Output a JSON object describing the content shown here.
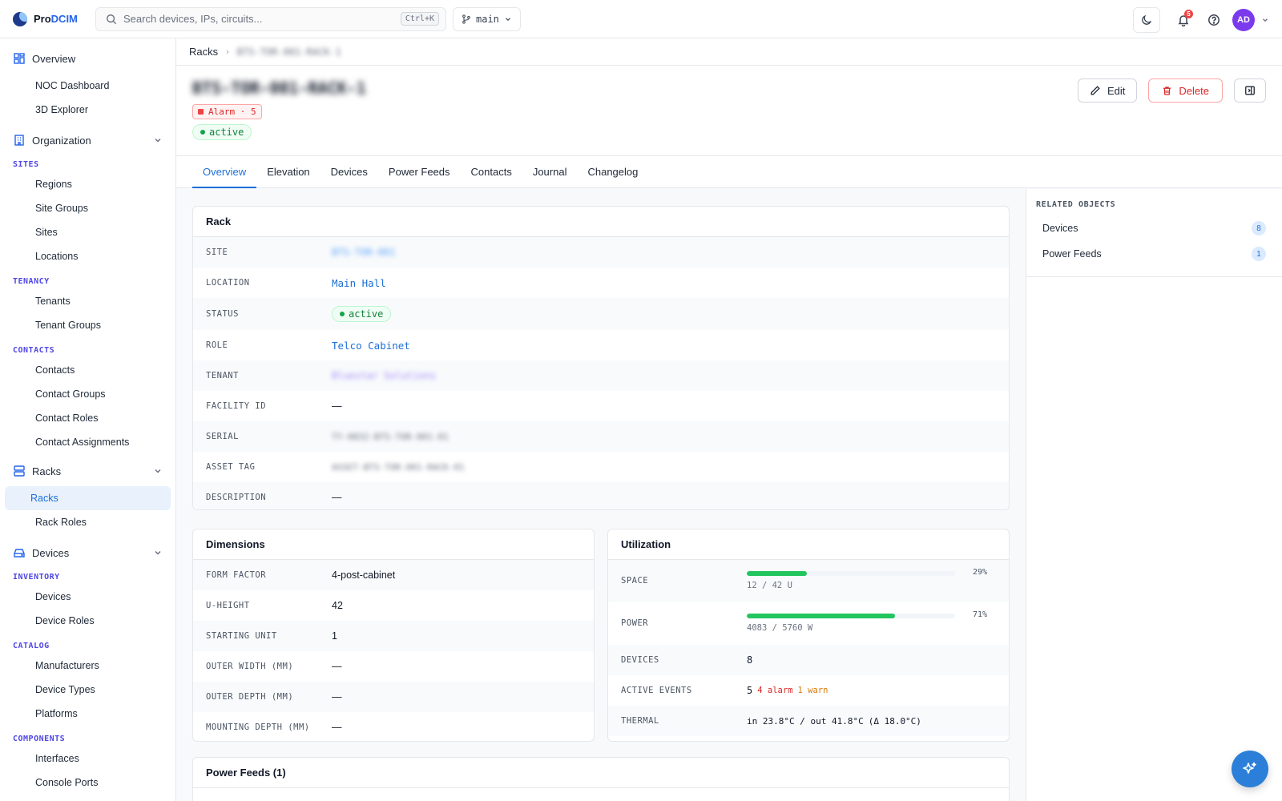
{
  "app": {
    "logo_prefix": "Pro",
    "logo_accent": "DCIM"
  },
  "search": {
    "placeholder": "Search devices, IPs, circuits...",
    "shortcut": "Ctrl+K"
  },
  "branch": {
    "label": "main"
  },
  "topbar": {
    "notification_count": "5",
    "avatar_initials": "AD"
  },
  "sidebar": {
    "overview": {
      "label": "Overview",
      "items": [
        "NOC Dashboard",
        "3D Explorer"
      ]
    },
    "organization": {
      "label": "Organization",
      "sites_cat": "SITES",
      "sites": [
        "Regions",
        "Site Groups",
        "Sites",
        "Locations"
      ],
      "tenancy_cat": "TENANCY",
      "tenancy": [
        "Tenants",
        "Tenant Groups"
      ],
      "contacts_cat": "CONTACTS",
      "contacts": [
        "Contacts",
        "Contact Groups",
        "Contact Roles",
        "Contact Assignments"
      ]
    },
    "racks": {
      "label": "Racks",
      "items": [
        "Racks",
        "Rack Roles"
      ]
    },
    "devices": {
      "label": "Devices",
      "inventory_cat": "INVENTORY",
      "inventory": [
        "Devices",
        "Device Roles"
      ],
      "catalog_cat": "CATALOG",
      "catalog": [
        "Manufacturers",
        "Device Types",
        "Platforms"
      ],
      "components_cat": "COMPONENTS",
      "components": [
        "Interfaces",
        "Console Ports"
      ]
    }
  },
  "breadcrumb": {
    "parent": "Racks",
    "current": "BTS-TOR-001-RACK-1"
  },
  "header": {
    "title": "BTS-TOR-001-RACK-1",
    "alarm_label": "Alarm · 5",
    "status": "active",
    "edit_label": "Edit",
    "delete_label": "Delete"
  },
  "tabs": [
    "Overview",
    "Elevation",
    "Devices",
    "Power Feeds",
    "Contacts",
    "Journal",
    "Changelog"
  ],
  "rack_card": {
    "title": "Rack",
    "site_label": "SITE",
    "site_value": "BTS-TOR-001",
    "location_label": "LOCATION",
    "location_value": "Main Hall",
    "status_label": "STATUS",
    "status_value": "active",
    "role_label": "ROLE",
    "role_value": "Telco Cabinet",
    "tenant_label": "TENANT",
    "tenant_value": "Bluestar Solutions",
    "facility_label": "FACILITY ID",
    "facility_value": "—",
    "serial_label": "SERIAL",
    "serial_value": "TY-0832-BTS-TOR-001-01",
    "asset_label": "ASSET TAG",
    "asset_value": "ASSET-BTS-TOR-001-RACK-01",
    "desc_label": "DESCRIPTION",
    "desc_value": "—"
  },
  "dimensions": {
    "title": "Dimensions",
    "form_factor_label": "FORM FACTOR",
    "form_factor_value": "4-post-cabinet",
    "u_height_label": "U-HEIGHT",
    "u_height_value": "42",
    "starting_unit_label": "STARTING UNIT",
    "starting_unit_value": "1",
    "outer_width_label": "OUTER WIDTH (MM)",
    "outer_width_value": "—",
    "outer_depth_label": "OUTER DEPTH (MM)",
    "outer_depth_value": "—",
    "mounting_depth_label": "MOUNTING DEPTH (MM)",
    "mounting_depth_value": "—"
  },
  "utilization": {
    "title": "Utilization",
    "space_label": "SPACE",
    "space_pct": "29%",
    "space_fraction": 0.29,
    "space_sub": "12 / 42 U",
    "power_label": "POWER",
    "power_pct": "71%",
    "power_fraction": 0.71,
    "power_sub": "4083 / 5760 W",
    "devices_label": "DEVICES",
    "devices_value": "8",
    "events_label": "ACTIVE EVENTS",
    "events_value": "5",
    "events_alarm": "4 alarm",
    "events_warn": "1 warn",
    "thermal_label": "THERMAL",
    "thermal_value": "in 23.8°C / out 41.8°C",
    "thermal_delta": "(Δ 18.0°C)"
  },
  "power_feeds": {
    "title": "Power Feeds (1)"
  },
  "related": {
    "title": "RELATED OBJECTS",
    "items": [
      {
        "label": "Devices",
        "count": "8"
      },
      {
        "label": "Power Feeds",
        "count": "1"
      }
    ]
  },
  "colors": {
    "accent": "#1d6fd6",
    "success": "#22c55e",
    "danger": "#dc2626",
    "warn": "#d97706"
  }
}
